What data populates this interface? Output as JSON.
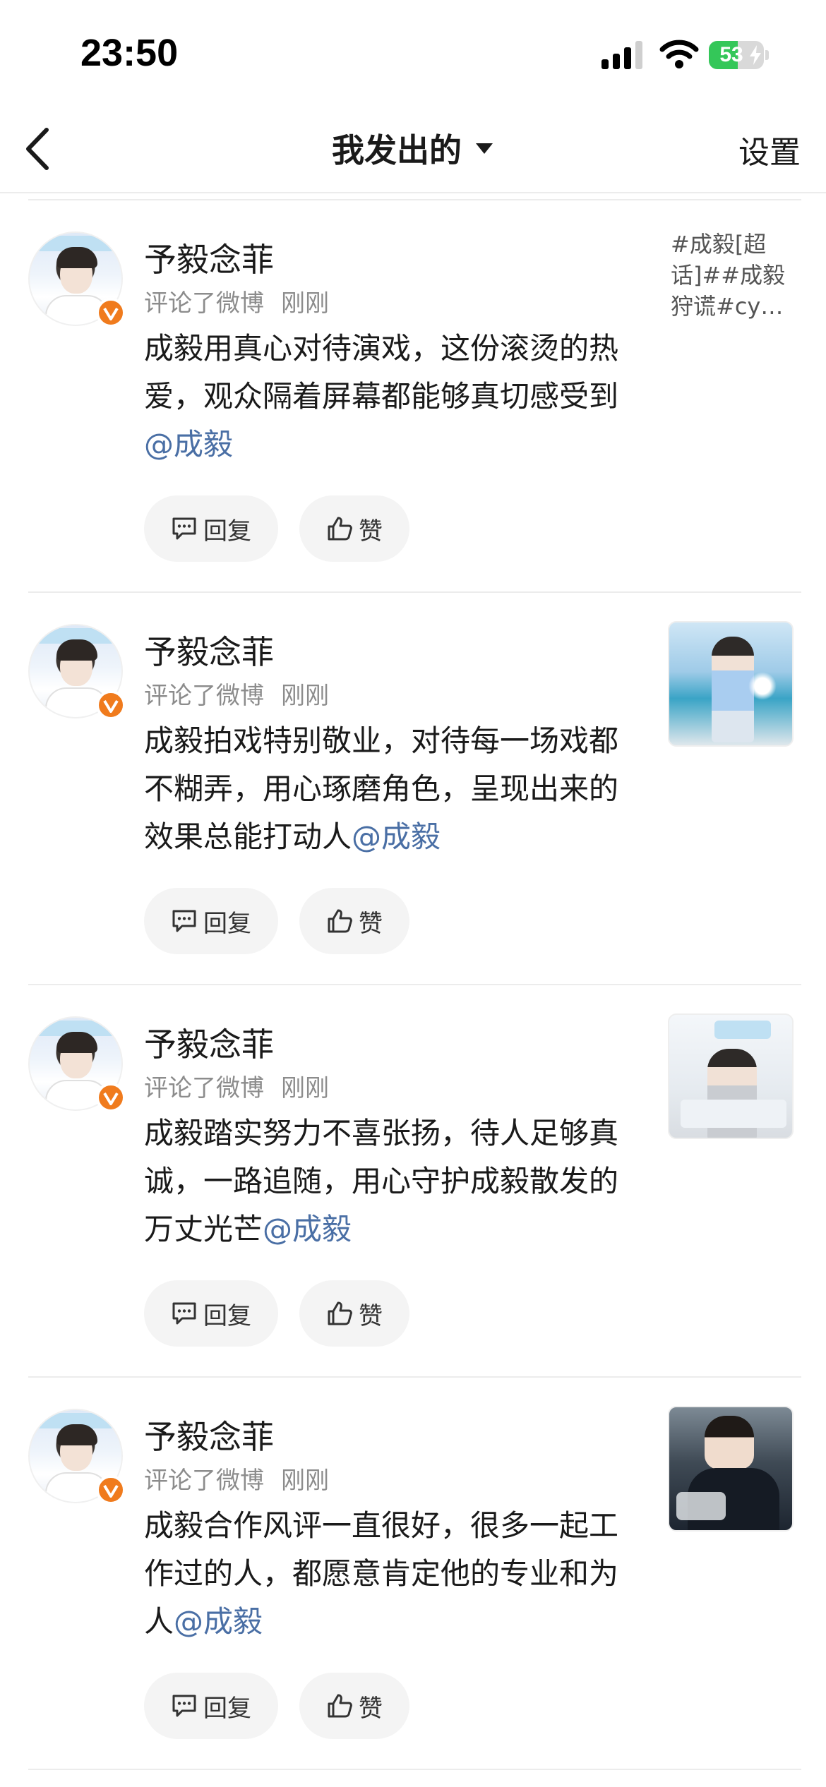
{
  "status_bar": {
    "time": "23:50",
    "battery_percent": "53",
    "battery_level": 0.53
  },
  "nav": {
    "title": "我发出的",
    "settings_label": "设置"
  },
  "feed": [
    {
      "author": "予毅念菲",
      "action": "评论了微博",
      "time": "刚刚",
      "text": "成毅用真心对待演戏，这份滚烫的热爱，观众隔着屏幕都能够真切感受到",
      "mention": "@成毅",
      "reply_label": "回复",
      "like_label": "赞",
      "thumb_type": "text",
      "thumb_text": [
        "#成毅[超",
        "话]##成毅",
        "狩谎#cy…"
      ]
    },
    {
      "author": "予毅念菲",
      "action": "评论了微博",
      "time": "刚刚",
      "text": "成毅拍戏特别敬业，对待每一场戏都不糊弄，用心琢磨角色，呈现出来的效果总能打动人",
      "mention": "@成毅",
      "reply_label": "回复",
      "like_label": "赞",
      "thumb_type": "stadium-photo"
    },
    {
      "author": "予毅念菲",
      "action": "评论了微博",
      "time": "刚刚",
      "text": "成毅踏实努力不喜张扬，待人足够真诚，一路追随，用心守护成毅散发的万丈光芒",
      "mention": "@成毅",
      "reply_label": "回复",
      "like_label": "赞",
      "thumb_type": "room-photo"
    },
    {
      "author": "予毅念菲",
      "action": "评论了微博",
      "time": "刚刚",
      "text": "成毅合作风评一直很好，很多一起工作过的人，都愿意肯定他的专业和为人",
      "mention": "@成毅",
      "reply_label": "回复",
      "like_label": "赞",
      "thumb_type": "dark-photo"
    }
  ],
  "colors": {
    "mention": "#4a6fa5",
    "verified": "#f07b1d",
    "battery": "#34c759",
    "meta": "#8c8c8c"
  }
}
